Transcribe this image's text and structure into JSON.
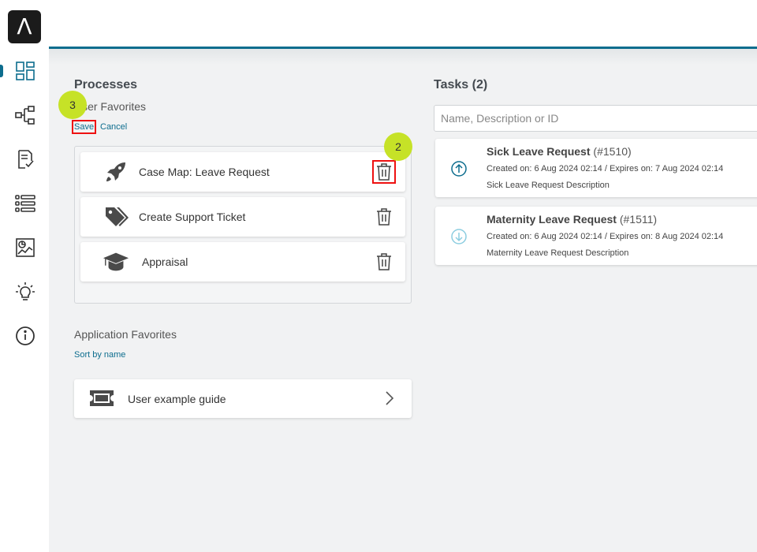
{
  "brand": {
    "logo_letter": "Λ"
  },
  "sidebar": {
    "items": [
      {
        "name": "dashboard-icon"
      },
      {
        "name": "process-flow-icon"
      },
      {
        "name": "checklist-icon"
      },
      {
        "name": "list-icon"
      },
      {
        "name": "report-icon"
      },
      {
        "name": "lightbulb-icon"
      },
      {
        "name": "info-icon"
      }
    ]
  },
  "processes": {
    "title": "Processes",
    "user_favorites_label": "User Favorites",
    "save_label": "Save",
    "cancel_label": "Cancel",
    "items": [
      {
        "label": "Case Map: Leave Request",
        "icon": "rocket-icon"
      },
      {
        "label": "Create Support Ticket",
        "icon": "tags-icon"
      },
      {
        "label": "Appraisal",
        "icon": "graduation-cap-icon"
      }
    ],
    "app_favorites_label": "Application Favorites",
    "sort_label": "Sort by name",
    "apps": [
      {
        "label": "User example guide",
        "icon": "ticket-icon"
      }
    ]
  },
  "tasks": {
    "title": "Tasks (2)",
    "search_placeholder": "Name, Description or ID",
    "items": [
      {
        "name": "Sick Leave Request",
        "id": "(#1510)",
        "meta": "Created on: 6 Aug 2024 02:14 / Expires on: 7 Aug 2024 02:14",
        "desc": "Sick Leave Request Description",
        "icon": "arrow-up-circle-icon"
      },
      {
        "name": "Maternity Leave Request",
        "id": "(#1511)",
        "meta": "Created on: 6 Aug 2024 02:14 / Expires on: 8 Aug 2024 02:14",
        "desc": "Maternity Leave Request Description",
        "icon": "arrow-down-circle-icon"
      }
    ]
  },
  "steps": {
    "save_step": "3",
    "trash_step": "2"
  },
  "colors": {
    "accent": "#0d6d8e",
    "step_badge": "#c6e227",
    "highlight": "#e11111"
  }
}
